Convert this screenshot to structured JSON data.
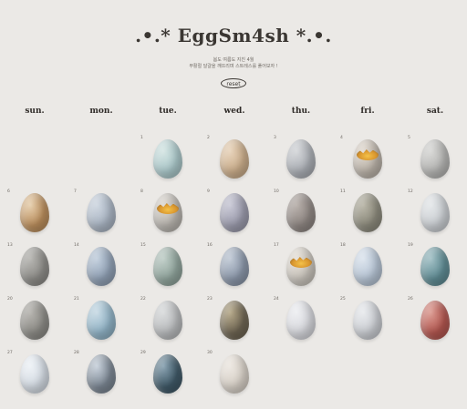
{
  "header": {
    "title": ".•.* EggSm4sh *.•.",
    "subtitle_line1": "봄도 여름도 지친 4월",
    "subtitle_line2": "부활절 달걀을 깨뜨리며 스트레스를 풀어보자 !",
    "reset_label": "reset"
  },
  "weekdays": [
    "sun.",
    "mon.",
    "tue.",
    "wed.",
    "thu.",
    "fri.",
    "sat."
  ],
  "days": [
    {
      "n": "1",
      "col": 2,
      "row": 0,
      "color": "#a9c6c8",
      "pattern": "#d6e6e4",
      "broken": false
    },
    {
      "n": "2",
      "col": 3,
      "row": 0,
      "color": "#c9ac8a",
      "pattern": "#e7d3bb",
      "broken": false
    },
    {
      "n": "3",
      "col": 4,
      "row": 0,
      "color": "#a9adb3",
      "pattern": "#d5d7da",
      "broken": false
    },
    {
      "n": "4",
      "col": 5,
      "row": 0,
      "color": "#b9b1a7",
      "pattern": "#e2dbd2",
      "broken": true
    },
    {
      "n": "5",
      "col": 6,
      "row": 0,
      "color": "#b4b4b2",
      "pattern": "#d8d8d6",
      "broken": false
    },
    {
      "n": "6",
      "col": 0,
      "row": 1,
      "color": "#b98d5c",
      "pattern": "#e6cfae",
      "broken": false
    },
    {
      "n": "7",
      "col": 1,
      "row": 1,
      "color": "#a9b4c2",
      "pattern": "#cfd7e1",
      "broken": false
    },
    {
      "n": "8",
      "col": 2,
      "row": 1,
      "color": "#b7b3ad",
      "pattern": "#dedad4",
      "broken": true
    },
    {
      "n": "9",
      "col": 3,
      "row": 1,
      "color": "#9a9aab",
      "pattern": "#c9c9d6",
      "broken": false
    },
    {
      "n": "10",
      "col": 4,
      "row": 1,
      "color": "#8e8682",
      "pattern": "#b7afaa",
      "broken": false
    },
    {
      "n": "11",
      "col": 5,
      "row": 1,
      "color": "#8c8a7c",
      "pattern": "#b9b6a8",
      "broken": false
    },
    {
      "n": "12",
      "col": 6,
      "row": 1,
      "color": "#c9cdd1",
      "pattern": "#e5e8ea",
      "broken": false
    },
    {
      "n": "13",
      "col": 0,
      "row": 2,
      "color": "#8d8c88",
      "pattern": "#b6b5b1",
      "broken": false
    },
    {
      "n": "14",
      "col": 1,
      "row": 2,
      "color": "#8f9fb3",
      "pattern": "#c3d0de",
      "broken": false
    },
    {
      "n": "15",
      "col": 2,
      "row": 2,
      "color": "#8fa39b",
      "pattern": "#c0cec8",
      "broken": false
    },
    {
      "n": "16",
      "col": 3,
      "row": 2,
      "color": "#8a96a8",
      "pattern": "#c1cad6",
      "broken": false
    },
    {
      "n": "17",
      "col": 4,
      "row": 2,
      "color": "#c7c2ba",
      "pattern": "#e6e1d9",
      "broken": true
    },
    {
      "n": "18",
      "col": 5,
      "row": 2,
      "color": "#b5c3d3",
      "pattern": "#dde5ee",
      "broken": false
    },
    {
      "n": "19",
      "col": 6,
      "row": 2,
      "color": "#5f8b93",
      "pattern": "#a3c1c6",
      "broken": false
    },
    {
      "n": "20",
      "col": 0,
      "row": 3,
      "color": "#8c8b86",
      "pattern": "#b5b3ae",
      "broken": false
    },
    {
      "n": "21",
      "col": 1,
      "row": 3,
      "color": "#8fb1c4",
      "pattern": "#c9dbe5",
      "broken": false
    },
    {
      "n": "22",
      "col": 2,
      "row": 3,
      "color": "#b7b9bb",
      "pattern": "#dadcdd",
      "broken": false
    },
    {
      "n": "23",
      "col": 3,
      "row": 3,
      "color": "#6d6452",
      "pattern": "#b6a98a",
      "broken": false
    },
    {
      "n": "24",
      "col": 4,
      "row": 3,
      "color": "#d5d6db",
      "pattern": "#eeeff2",
      "broken": false
    },
    {
      "n": "25",
      "col": 5,
      "row": 3,
      "color": "#c9ccd1",
      "pattern": "#e9ebee",
      "broken": false
    },
    {
      "n": "26",
      "col": 6,
      "row": 3,
      "color": "#b1564f",
      "pattern": "#dc9c93",
      "broken": false
    },
    {
      "n": "27",
      "col": 0,
      "row": 4,
      "color": "#d3dae2",
      "pattern": "#eef2f6",
      "broken": false
    },
    {
      "n": "28",
      "col": 1,
      "row": 4,
      "color": "#7a8591",
      "pattern": "#c9d2dc",
      "broken": false
    },
    {
      "n": "29",
      "col": 2,
      "row": 4,
      "color": "#3f5866",
      "pattern": "#8aa3b2",
      "broken": false
    },
    {
      "n": "30",
      "col": 3,
      "row": 4,
      "color": "#d6cfc6",
      "pattern": "#ece7e1",
      "broken": false
    }
  ]
}
